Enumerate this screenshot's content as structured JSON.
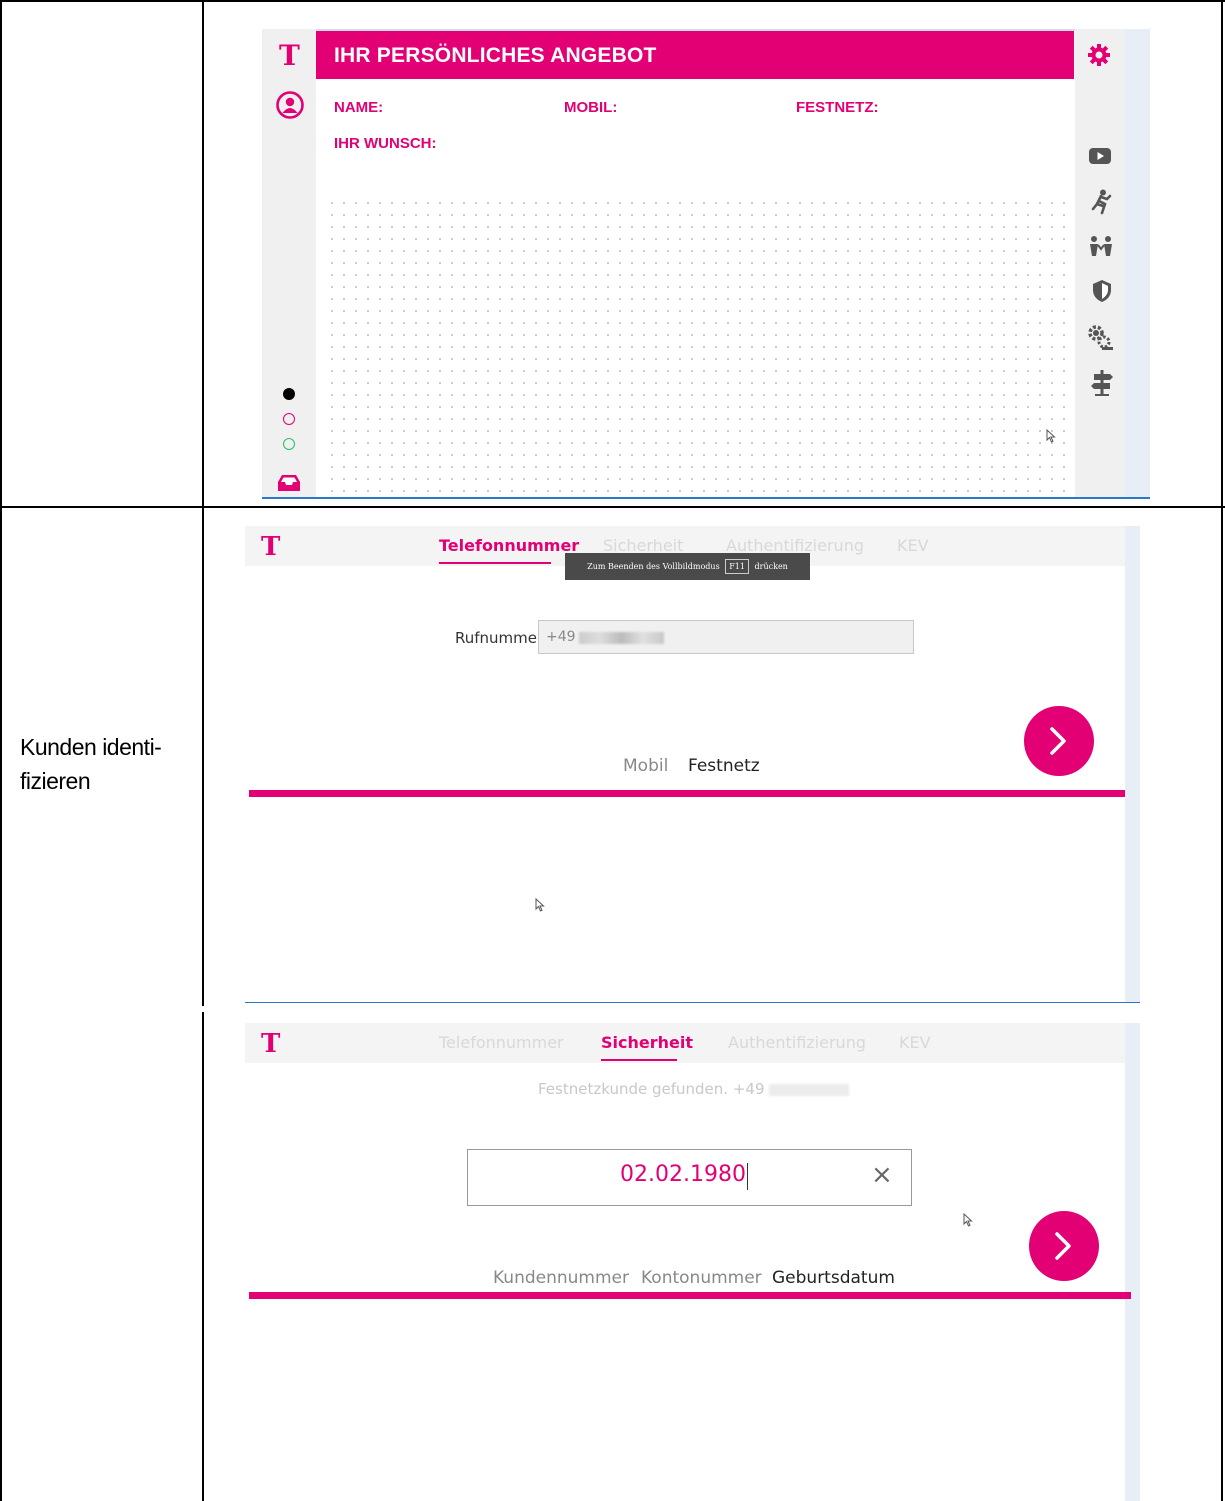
{
  "table": {
    "row_label": "Kunden identi-\nfizieren"
  },
  "offer_screen": {
    "logo": "T",
    "title": "IHR PERSÖNLICHES ANGEBOT",
    "fields": {
      "name": "NAME:",
      "mobil": "MOBIL:",
      "festnetz": "FESTNETZ:",
      "wunsch": "IHR WUNSCH:"
    },
    "status_dots": [
      "#000000",
      "#e20074",
      "#22c55e"
    ],
    "sidebar_icons": [
      "video-icon",
      "running-icon",
      "family-icon",
      "shield-icon",
      "gears-icon",
      "signpost-icon"
    ],
    "accent": "#e20074"
  },
  "phone_screen": {
    "logo": "T",
    "tabs": [
      "Telefonnummer",
      "Sicherheit",
      "Authentifizierung",
      "KEV"
    ],
    "active_tab": "Telefonnummer",
    "fullscreen_hint": {
      "before": "Zum Beenden des Vollbildmodus",
      "key": "F11",
      "after": "drücken"
    },
    "field_label": "Rufnummer",
    "field_value": "+49",
    "options": [
      "Mobil",
      "Festnetz"
    ],
    "selected_option": "Festnetz"
  },
  "security_screen": {
    "logo": "T",
    "tabs": [
      "Telefonnummer",
      "Sicherheit",
      "Authentifizierung",
      "KEV"
    ],
    "active_tab": "Sicherheit",
    "found_text": "Festnetzkunde gefunden.",
    "found_prefix": "+49",
    "input_value": "02.02.1980",
    "clear_glyph": "×",
    "options": [
      "Kundennummer",
      "Kontonummer",
      "Geburtsdatum"
    ],
    "selected_option": "Geburtsdatum"
  }
}
